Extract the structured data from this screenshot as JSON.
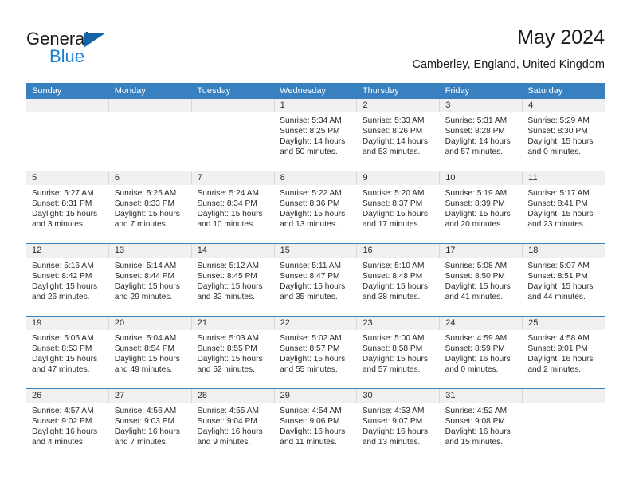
{
  "brand": {
    "name_part1": "General",
    "name_part2": "Blue",
    "accent_color": "#1b7fd4",
    "triangle_color": "#1464a5"
  },
  "header": {
    "title": "May 2024",
    "subtitle": "Camberley, England, United Kingdom"
  },
  "calendar": {
    "header_bg": "#3880c0",
    "daynumber_bg": "#f0f0f0",
    "weekdays": [
      "Sunday",
      "Monday",
      "Tuesday",
      "Wednesday",
      "Thursday",
      "Friday",
      "Saturday"
    ],
    "weeks": [
      {
        "days": [
          {
            "num": "",
            "lines": [
              "",
              "",
              "",
              ""
            ]
          },
          {
            "num": "",
            "lines": [
              "",
              "",
              "",
              ""
            ]
          },
          {
            "num": "",
            "lines": [
              "",
              "",
              "",
              ""
            ]
          },
          {
            "num": "1",
            "lines": [
              "Sunrise: 5:34 AM",
              "Sunset: 8:25 PM",
              "Daylight: 14 hours",
              "and 50 minutes."
            ]
          },
          {
            "num": "2",
            "lines": [
              "Sunrise: 5:33 AM",
              "Sunset: 8:26 PM",
              "Daylight: 14 hours",
              "and 53 minutes."
            ]
          },
          {
            "num": "3",
            "lines": [
              "Sunrise: 5:31 AM",
              "Sunset: 8:28 PM",
              "Daylight: 14 hours",
              "and 57 minutes."
            ]
          },
          {
            "num": "4",
            "lines": [
              "Sunrise: 5:29 AM",
              "Sunset: 8:30 PM",
              "Daylight: 15 hours",
              "and 0 minutes."
            ]
          }
        ]
      },
      {
        "days": [
          {
            "num": "5",
            "lines": [
              "Sunrise: 5:27 AM",
              "Sunset: 8:31 PM",
              "Daylight: 15 hours",
              "and 3 minutes."
            ]
          },
          {
            "num": "6",
            "lines": [
              "Sunrise: 5:25 AM",
              "Sunset: 8:33 PM",
              "Daylight: 15 hours",
              "and 7 minutes."
            ]
          },
          {
            "num": "7",
            "lines": [
              "Sunrise: 5:24 AM",
              "Sunset: 8:34 PM",
              "Daylight: 15 hours",
              "and 10 minutes."
            ]
          },
          {
            "num": "8",
            "lines": [
              "Sunrise: 5:22 AM",
              "Sunset: 8:36 PM",
              "Daylight: 15 hours",
              "and 13 minutes."
            ]
          },
          {
            "num": "9",
            "lines": [
              "Sunrise: 5:20 AM",
              "Sunset: 8:37 PM",
              "Daylight: 15 hours",
              "and 17 minutes."
            ]
          },
          {
            "num": "10",
            "lines": [
              "Sunrise: 5:19 AM",
              "Sunset: 8:39 PM",
              "Daylight: 15 hours",
              "and 20 minutes."
            ]
          },
          {
            "num": "11",
            "lines": [
              "Sunrise: 5:17 AM",
              "Sunset: 8:41 PM",
              "Daylight: 15 hours",
              "and 23 minutes."
            ]
          }
        ]
      },
      {
        "days": [
          {
            "num": "12",
            "lines": [
              "Sunrise: 5:16 AM",
              "Sunset: 8:42 PM",
              "Daylight: 15 hours",
              "and 26 minutes."
            ]
          },
          {
            "num": "13",
            "lines": [
              "Sunrise: 5:14 AM",
              "Sunset: 8:44 PM",
              "Daylight: 15 hours",
              "and 29 minutes."
            ]
          },
          {
            "num": "14",
            "lines": [
              "Sunrise: 5:12 AM",
              "Sunset: 8:45 PM",
              "Daylight: 15 hours",
              "and 32 minutes."
            ]
          },
          {
            "num": "15",
            "lines": [
              "Sunrise: 5:11 AM",
              "Sunset: 8:47 PM",
              "Daylight: 15 hours",
              "and 35 minutes."
            ]
          },
          {
            "num": "16",
            "lines": [
              "Sunrise: 5:10 AM",
              "Sunset: 8:48 PM",
              "Daylight: 15 hours",
              "and 38 minutes."
            ]
          },
          {
            "num": "17",
            "lines": [
              "Sunrise: 5:08 AM",
              "Sunset: 8:50 PM",
              "Daylight: 15 hours",
              "and 41 minutes."
            ]
          },
          {
            "num": "18",
            "lines": [
              "Sunrise: 5:07 AM",
              "Sunset: 8:51 PM",
              "Daylight: 15 hours",
              "and 44 minutes."
            ]
          }
        ]
      },
      {
        "days": [
          {
            "num": "19",
            "lines": [
              "Sunrise: 5:05 AM",
              "Sunset: 8:53 PM",
              "Daylight: 15 hours",
              "and 47 minutes."
            ]
          },
          {
            "num": "20",
            "lines": [
              "Sunrise: 5:04 AM",
              "Sunset: 8:54 PM",
              "Daylight: 15 hours",
              "and 49 minutes."
            ]
          },
          {
            "num": "21",
            "lines": [
              "Sunrise: 5:03 AM",
              "Sunset: 8:55 PM",
              "Daylight: 15 hours",
              "and 52 minutes."
            ]
          },
          {
            "num": "22",
            "lines": [
              "Sunrise: 5:02 AM",
              "Sunset: 8:57 PM",
              "Daylight: 15 hours",
              "and 55 minutes."
            ]
          },
          {
            "num": "23",
            "lines": [
              "Sunrise: 5:00 AM",
              "Sunset: 8:58 PM",
              "Daylight: 15 hours",
              "and 57 minutes."
            ]
          },
          {
            "num": "24",
            "lines": [
              "Sunrise: 4:59 AM",
              "Sunset: 8:59 PM",
              "Daylight: 16 hours",
              "and 0 minutes."
            ]
          },
          {
            "num": "25",
            "lines": [
              "Sunrise: 4:58 AM",
              "Sunset: 9:01 PM",
              "Daylight: 16 hours",
              "and 2 minutes."
            ]
          }
        ]
      },
      {
        "days": [
          {
            "num": "26",
            "lines": [
              "Sunrise: 4:57 AM",
              "Sunset: 9:02 PM",
              "Daylight: 16 hours",
              "and 4 minutes."
            ]
          },
          {
            "num": "27",
            "lines": [
              "Sunrise: 4:56 AM",
              "Sunset: 9:03 PM",
              "Daylight: 16 hours",
              "and 7 minutes."
            ]
          },
          {
            "num": "28",
            "lines": [
              "Sunrise: 4:55 AM",
              "Sunset: 9:04 PM",
              "Daylight: 16 hours",
              "and 9 minutes."
            ]
          },
          {
            "num": "29",
            "lines": [
              "Sunrise: 4:54 AM",
              "Sunset: 9:06 PM",
              "Daylight: 16 hours",
              "and 11 minutes."
            ]
          },
          {
            "num": "30",
            "lines": [
              "Sunrise: 4:53 AM",
              "Sunset: 9:07 PM",
              "Daylight: 16 hours",
              "and 13 minutes."
            ]
          },
          {
            "num": "31",
            "lines": [
              "Sunrise: 4:52 AM",
              "Sunset: 9:08 PM",
              "Daylight: 16 hours",
              "and 15 minutes."
            ]
          },
          {
            "num": "",
            "lines": [
              "",
              "",
              "",
              ""
            ]
          }
        ]
      }
    ]
  }
}
